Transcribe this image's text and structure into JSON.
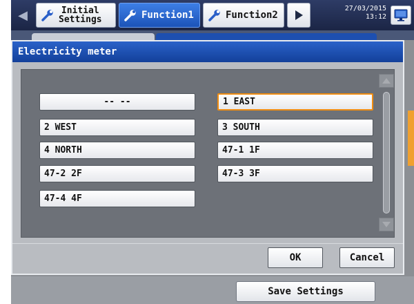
{
  "toolbar": {
    "tabs": [
      {
        "label_line1": "Initial",
        "label_line2": "Settings",
        "active": false
      },
      {
        "label": "Function1",
        "active": true
      },
      {
        "label": "Function2",
        "active": false
      }
    ],
    "datetime": {
      "date": "27/03/2015",
      "time": "13:12"
    },
    "icons": {
      "back": "left-arrow-icon",
      "forward": "play-arrow-icon",
      "tab": "wrench-icon",
      "monitor": "monitor-icon"
    }
  },
  "dialog": {
    "title": "Electricity meter",
    "meters": [
      {
        "label": "-- --",
        "selected": false
      },
      {
        "label": "1 EAST",
        "selected": true
      },
      {
        "label": "2 WEST",
        "selected": false
      },
      {
        "label": "3 SOUTH",
        "selected": false
      },
      {
        "label": "4 NORTH",
        "selected": false
      },
      {
        "label": "47-1 1F",
        "selected": false
      },
      {
        "label": "47-2 2F",
        "selected": false
      },
      {
        "label": "47-3 3F",
        "selected": false
      },
      {
        "label": "47-4 4F",
        "selected": false
      }
    ],
    "ok_label": "OK",
    "cancel_label": "Cancel"
  },
  "footer": {
    "save_label": "Save Settings"
  },
  "colors": {
    "accent": "#1c53b8",
    "selection": "#f08c10",
    "title_bar": "#13409a"
  }
}
